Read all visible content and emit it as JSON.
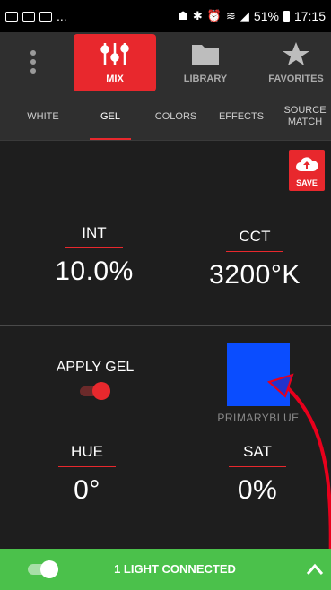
{
  "status_bar": {
    "left_extra": "...",
    "battery": "51%",
    "time": "17:15",
    "icons_left": [
      "image-icon",
      "outlook-icon",
      "mail-icon"
    ],
    "icons_right": [
      "android-icon",
      "bluetooth-icon",
      "alarm-icon",
      "wifi-icon",
      "signal-icon",
      "battery-icon"
    ]
  },
  "mode_tabs": [
    {
      "label": "MIX",
      "icon": "sliders-icon",
      "active": true
    },
    {
      "label": "LIBRARY",
      "icon": "folder-icon",
      "active": false
    },
    {
      "label": "FAVORITES",
      "icon": "star-icon",
      "active": false
    }
  ],
  "sub_tabs": [
    {
      "label": "WHITE",
      "active": false
    },
    {
      "label": "GEL",
      "active": true
    },
    {
      "label": "COLORS",
      "active": false
    },
    {
      "label": "EFFECTS",
      "active": false
    },
    {
      "label": "SOURCE MATCH",
      "active": false
    }
  ],
  "save": {
    "label": "SAVE",
    "icon": "cloud-upload-icon"
  },
  "intensity": {
    "label": "INT",
    "value": "10.0%"
  },
  "cct": {
    "label": "CCT",
    "value": "3200°K"
  },
  "gel": {
    "apply_label": "APPLY GEL",
    "apply_on": true,
    "swatch_color": "#0a4dff",
    "swatch_label": "PRIMARYBLUE"
  },
  "hue": {
    "label": "HUE",
    "value": "0°"
  },
  "sat": {
    "label": "SAT",
    "value": "0%"
  },
  "connection": {
    "label": "1 LIGHT CONNECTED",
    "toggle_on": true
  },
  "colors": {
    "accent": "#e8282d",
    "connected": "#4bc14b",
    "background": "#1e1e1e"
  }
}
